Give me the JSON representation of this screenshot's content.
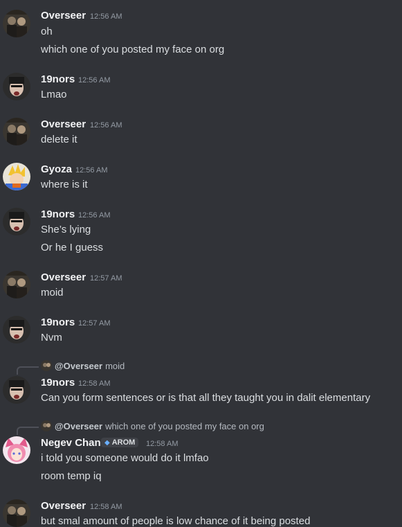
{
  "messages": [
    {
      "author": "Overseer",
      "time": "12:56 AM",
      "avatar": "overseer",
      "lines": [
        "oh",
        "which one of you posted my face on org"
      ]
    },
    {
      "author": "19nors",
      "time": "12:56 AM",
      "avatar": "19nors",
      "lines": [
        "Lmao"
      ]
    },
    {
      "author": "Overseer",
      "time": "12:56 AM",
      "avatar": "overseer",
      "lines": [
        "delete it"
      ]
    },
    {
      "author": "Gyoza",
      "time": "12:56 AM",
      "avatar": "gyoza",
      "lines": [
        "where is it"
      ]
    },
    {
      "author": "19nors",
      "time": "12:56 AM",
      "avatar": "19nors",
      "lines": [
        "She’s lying",
        "Or he I guess"
      ]
    },
    {
      "author": "Overseer",
      "time": "12:57 AM",
      "avatar": "overseer",
      "lines": [
        "moid"
      ]
    },
    {
      "author": "19nors",
      "time": "12:57 AM",
      "avatar": "19nors",
      "lines": [
        "Nvm"
      ]
    },
    {
      "author": "19nors",
      "time": "12:58 AM",
      "avatar": "19nors",
      "reply": {
        "author": "@Overseer",
        "text": "moid"
      },
      "lines": [
        "Can you form sentences or is that all they taught you in dalit elementary"
      ]
    },
    {
      "author": "Negev Chan",
      "time": "12:58 AM",
      "avatar": "negev",
      "badge": "AROM",
      "reply": {
        "author": "@Overseer",
        "text": "which one of you posted my face on org"
      },
      "lines": [
        "i told you someone would do it lmfao",
        "room temp iq"
      ]
    },
    {
      "author": "Overseer",
      "time": "12:58 AM",
      "avatar": "overseer",
      "lines": [
        "but smal amount of people is low chance of it being posted"
      ]
    }
  ],
  "colors": {
    "background": "#313338",
    "name": "#f2f3f5",
    "text": "#dbdee1",
    "timestamp": "#949ba4"
  }
}
